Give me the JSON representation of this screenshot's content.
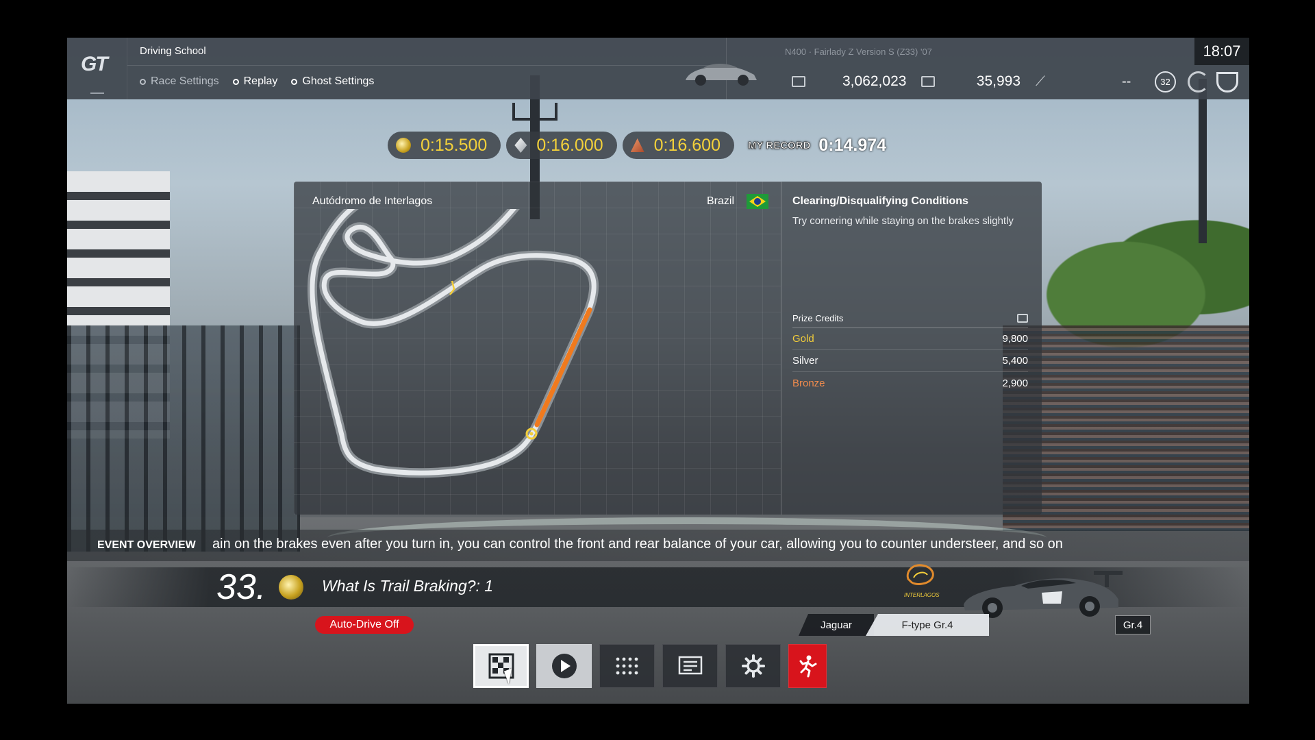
{
  "header": {
    "mode_title": "Driving School",
    "menu": [
      {
        "label": "Race Settings"
      },
      {
        "label": "Replay"
      },
      {
        "label": "Ghost Settings"
      }
    ],
    "car_label": "N400 · Fairlady Z Version S (Z33) '07",
    "credits": "3,062,023",
    "mileage": "35,993",
    "level_dash": "--",
    "level": "32",
    "clock": "18:07"
  },
  "targets": {
    "gold_time": "0:15.500",
    "silver_time": "0:16.000",
    "bronze_time": "0:16.600",
    "my_record_label": "MY RECORD",
    "my_record": "0:14.974"
  },
  "panel": {
    "track_name": "Autódromo de Interlagos",
    "country": "Brazil",
    "conditions_title": "Clearing/Disqualifying Conditions",
    "conditions_text": "Try cornering while staying on the brakes slightly",
    "prize_title": "Prize Credits",
    "prizes": [
      {
        "label": "Gold",
        "value": "9,800"
      },
      {
        "label": "Silver",
        "value": "5,400"
      },
      {
        "label": "Bronze",
        "value": "2,900"
      }
    ]
  },
  "event": {
    "overview_label": "EVENT OVERVIEW",
    "overview_text": "ain on the brakes even after you turn in, you can control the front and rear balance of your car, allowing you to counter understeer, and so on",
    "number": "33.",
    "title": "What Is Trail Braking?: 1",
    "circuit_logo_text": "INTERLAGOS",
    "auto_drive": "Auto-Drive Off",
    "car_make": "Jaguar",
    "car_model": "F-type Gr.4",
    "car_class": "Gr.4"
  },
  "actions": [
    {
      "name": "start-icon"
    },
    {
      "name": "play-icon"
    },
    {
      "name": "grid-icon"
    },
    {
      "name": "notes-icon"
    },
    {
      "name": "gear-icon"
    },
    {
      "name": "exit-icon"
    }
  ],
  "colors": {
    "gold": "#f2cd3a",
    "bronze": "#f08b4d",
    "accent_red": "#d8141c",
    "track_highlight": "#f07a1e"
  }
}
